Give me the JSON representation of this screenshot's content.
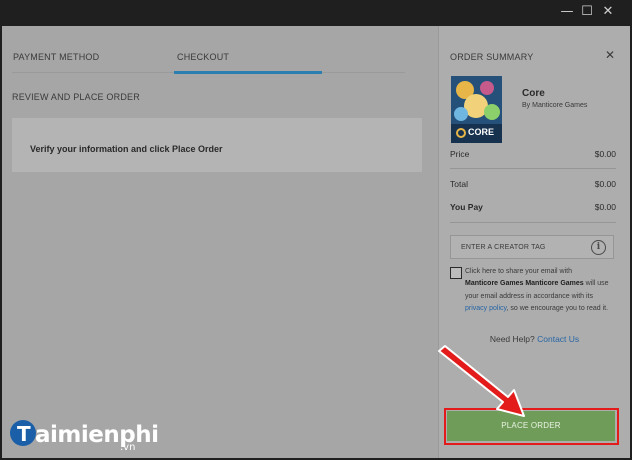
{
  "window": {
    "minimize_glyph": "—",
    "maximize_glyph": "☐",
    "close_glyph": "✕"
  },
  "tabs": [
    {
      "label": "PAYMENT METHOD",
      "active": false
    },
    {
      "label": "CHECKOUT",
      "active": true
    }
  ],
  "main": {
    "section_title": "REVIEW AND PLACE ORDER",
    "verify_text": "Verify your information and click Place Order"
  },
  "summary": {
    "title": "ORDER SUMMARY",
    "close_glyph": "✕",
    "product": {
      "name": "Core",
      "by": "By Manticore Games",
      "art_label": "CORE"
    },
    "price_label": "Price",
    "price_value": "$0.00",
    "total_label": "Total",
    "total_value": "$0.00",
    "you_pay_label": "You Pay",
    "you_pay_value": "$0.00",
    "creator_tag_placeholder": "ENTER A CREATOR TAG",
    "info_glyph": "i",
    "consent": {
      "part1": "Click here to share your email with",
      "bold1": "Manticore Games",
      "bold2": "Manticore Games",
      "part2": "will use your email address in accordance with its",
      "link": "privacy policy",
      "part3": ", so we encourage you to read it."
    },
    "help_text": "Need Help?",
    "help_link": "Contact Us",
    "place_order_label": "PLACE ORDER"
  },
  "watermark": {
    "brand": "aimienphi",
    "tld": ".vn"
  },
  "colors": {
    "accent_tab": "#2a7fb0",
    "place_order_bg": "#6f9d59",
    "highlight_red": "#e31b1b",
    "link_blue": "#2665a5"
  }
}
